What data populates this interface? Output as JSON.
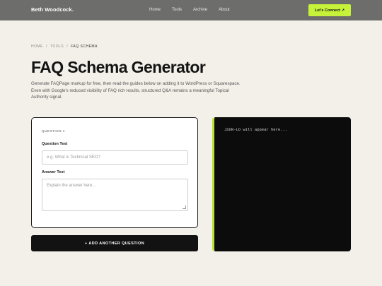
{
  "nav": {
    "brand": "Beth Woodcock.",
    "links": [
      "Home",
      "Tools",
      "Archive",
      "About"
    ],
    "cta": "Let's Connect ↗"
  },
  "breadcrumb": {
    "home": "HOME",
    "tools": "TOOLS",
    "current": "FAQ SCHEMA",
    "sep": "/"
  },
  "page": {
    "title": "FAQ Schema Generator",
    "intro": "Generate FAQPage markup for free, then read the guides below on adding it to WordPress or Squarespace. Even with Google's reduced visibility of FAQ rich results, structured Q&A remains a meaningful Topical Authority signal."
  },
  "form": {
    "question_label": "QUESTION 1",
    "question_text_label": "Question Text",
    "question_placeholder": "e.g. What is Technical SEO?",
    "answer_text_label": "Answer Text",
    "answer_placeholder": "Explain the answer here...",
    "add_button": "+ ADD ANOTHER QUESTION"
  },
  "output": {
    "placeholder": "JSON-LD will appear here..."
  },
  "colors": {
    "accent": "#c6f23a",
    "nav_bg": "#6d6d6b",
    "page_bg": "#f3f0e9"
  }
}
